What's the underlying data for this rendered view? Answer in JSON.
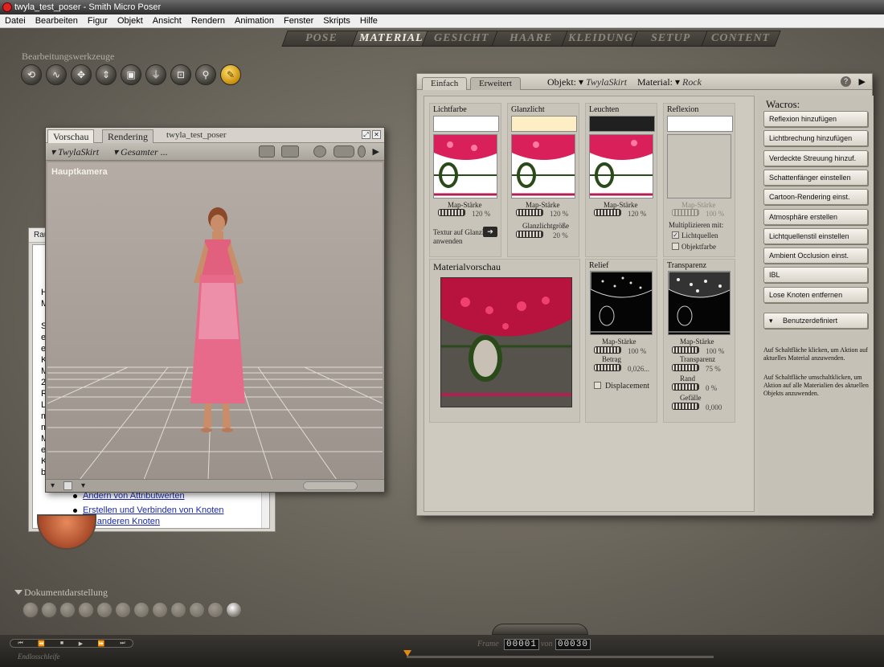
{
  "window": {
    "title": "twyla_test_poser - Smith Micro Poser"
  },
  "menu": [
    "Datei",
    "Bearbeiten",
    "Figur",
    "Objekt",
    "Ansicht",
    "Rendern",
    "Animation",
    "Fenster",
    "Skripts",
    "Hilfe"
  ],
  "rooms": {
    "tabs": [
      "POSE",
      "MATERIAL",
      "GESICHT",
      "HAARE",
      "KLEIDUNG",
      "SETUP",
      "CONTENT"
    ],
    "active": "MATERIAL"
  },
  "tools": {
    "label": "Bearbeitungswerkzeuge",
    "icons": [
      "rotate-icon",
      "twist-icon",
      "translate-icon",
      "translate-in-out-icon",
      "scale-icon",
      "taper-icon",
      "chain-break-icon",
      "zoom-icon",
      "color-dropper-icon"
    ],
    "selected": "color-dropper-icon"
  },
  "help": {
    "title": "Rau",
    "letters": "H\nM\n\nS\nei\nei\nK\nM\n2I\nR\nLi\nm\nm\nM\nei\nK\nbe",
    "links": [
      "Ändern von Attributwerten",
      "Erstellen und Verbinden von Knoten mit anderen Knoten"
    ]
  },
  "preview": {
    "tabs": [
      "Vorschau",
      "Rendering"
    ],
    "active_tab": "Vorschau",
    "doc_name": "twyla_test_poser",
    "figure_dropdown": "TwylaSkirt",
    "element_dropdown": "Gesamter ...",
    "camera_label": "Hauptkamera"
  },
  "material": {
    "tabs": [
      "Einfach",
      "Erweitert"
    ],
    "active_tab": "Einfach",
    "object_label": "Objekt:",
    "object_value": "TwylaSkirt",
    "material_label": "Material:",
    "material_value": "Rock",
    "help_icon": "?",
    "slots": {
      "lichtfarbe": {
        "title": "Lichtfarbe",
        "map_label": "Map-Stärke",
        "map_value": "120 %",
        "extra_label": "Textur auf Glanzlicht anwenden",
        "swatch": "#ffffff"
      },
      "glanzlicht": {
        "title": "Glanzlicht",
        "map_label": "Map-Stärke",
        "map_value": "120 %",
        "size_label": "Glanzlichtgröße",
        "size_value": "20 %",
        "swatch": "#fdeec4"
      },
      "leuchten": {
        "title": "Leuchten",
        "map_label": "Map-Stärke",
        "map_value": "120 %",
        "swatch": "#202020"
      },
      "reflexion": {
        "title": "Reflexion",
        "map_label": "Map-Stärke",
        "map_value": "100 %",
        "multiply_label": "Multiplizieren mit:",
        "opt1": "Lichtquellen",
        "opt1_checked": true,
        "opt2": "Objektfarbe",
        "opt2_checked": false,
        "swatch": "#ffffff"
      }
    },
    "preview_title": "Materialvorschau",
    "relief": {
      "title": "Relief",
      "map_label": "Map-Stärke",
      "map_value": "100 %",
      "amount_label": "Betrag",
      "amount_value": "0,026...",
      "displacement_label": "Displacement"
    },
    "transparenz": {
      "title": "Transparenz",
      "map_label": "Map-Stärke",
      "map_value": "100 %",
      "trans_label": "Transparenz",
      "trans_value": "75 %",
      "edge_label": "Rand",
      "edge_value": "0 %",
      "falloff_label": "Gefälle",
      "falloff_value": "0,000"
    }
  },
  "wacros": {
    "title": "Wacros:",
    "buttons": [
      "Reflexion hinzufügen",
      "Lichtbrechung hinzufügen",
      "Verdeckte Streuung hinzuf.",
      "Schattenfänger einstellen",
      "Cartoon-Rendering einst.",
      "Atmosphäre erstellen",
      "Lichtquellenstil einstellen",
      "Ambient Occlusion einst.",
      "IBL",
      "Lose Knoten entfernen"
    ],
    "custom_label": "Benutzerdefiniert",
    "hint1": "Auf Schaltfläche klicken, um Aktion auf aktuelles Material anzuwenden.",
    "hint2": "Auf Schaltfläche umschaltklicken, um Aktion auf alle Materialien des aktuellen Objekts anzuwenden."
  },
  "doc_display": {
    "label": "Dokumentdarstellung",
    "styles": 12,
    "selected_index": 11
  },
  "animation": {
    "frame_label": "Frame",
    "frame_value": "00001",
    "of_label": "von",
    "total_value": "00030",
    "loop_label": "Endlosschleife"
  }
}
